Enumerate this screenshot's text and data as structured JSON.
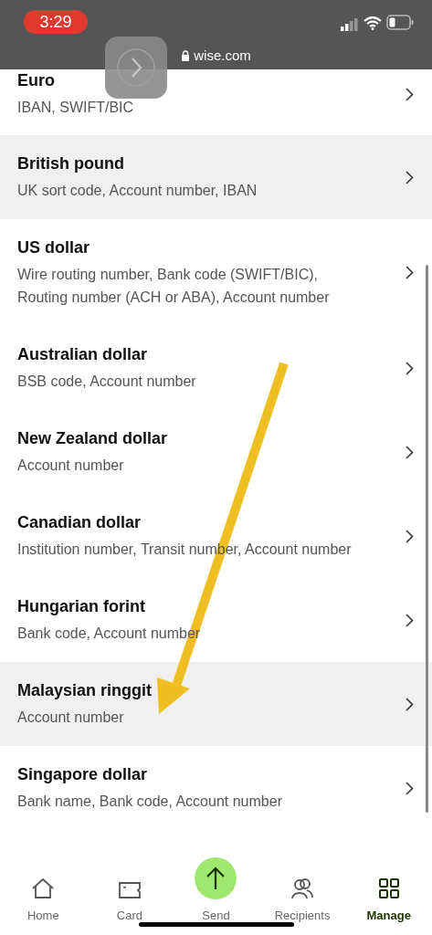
{
  "status_bar": {
    "time": "3:29",
    "url": "wise.com"
  },
  "currencies": [
    {
      "name": "Euro",
      "details": "IBAN, SWIFT/BIC",
      "selected": false
    },
    {
      "name": "British pound",
      "details": "UK sort code, Account number, IBAN",
      "selected": true
    },
    {
      "name": "US dollar",
      "details": "Wire routing number, Bank code (SWIFT/BIC), Routing number (ACH or ABA), Account number",
      "selected": false
    },
    {
      "name": "Australian dollar",
      "details": "BSB code, Account number",
      "selected": false
    },
    {
      "name": "New Zealand dollar",
      "details": "Account number",
      "selected": false
    },
    {
      "name": "Canadian dollar",
      "details": "Institution number, Transit number, Account number",
      "selected": false
    },
    {
      "name": "Hungarian forint",
      "details": "Bank code, Account number",
      "selected": false
    },
    {
      "name": "Malaysian ringgit",
      "details": "Account number",
      "selected": true
    },
    {
      "name": "Singapore dollar",
      "details": "Bank name, Bank code, Account number",
      "selected": false
    }
  ],
  "tab_bar": [
    {
      "label": "Home",
      "kind": "home",
      "selected": false
    },
    {
      "label": "Card",
      "kind": "card",
      "selected": false
    },
    {
      "label": "Send",
      "kind": "send",
      "selected": false
    },
    {
      "label": "Recipients",
      "kind": "recipients",
      "selected": false
    },
    {
      "label": "Manage",
      "kind": "manage",
      "selected": true
    }
  ]
}
